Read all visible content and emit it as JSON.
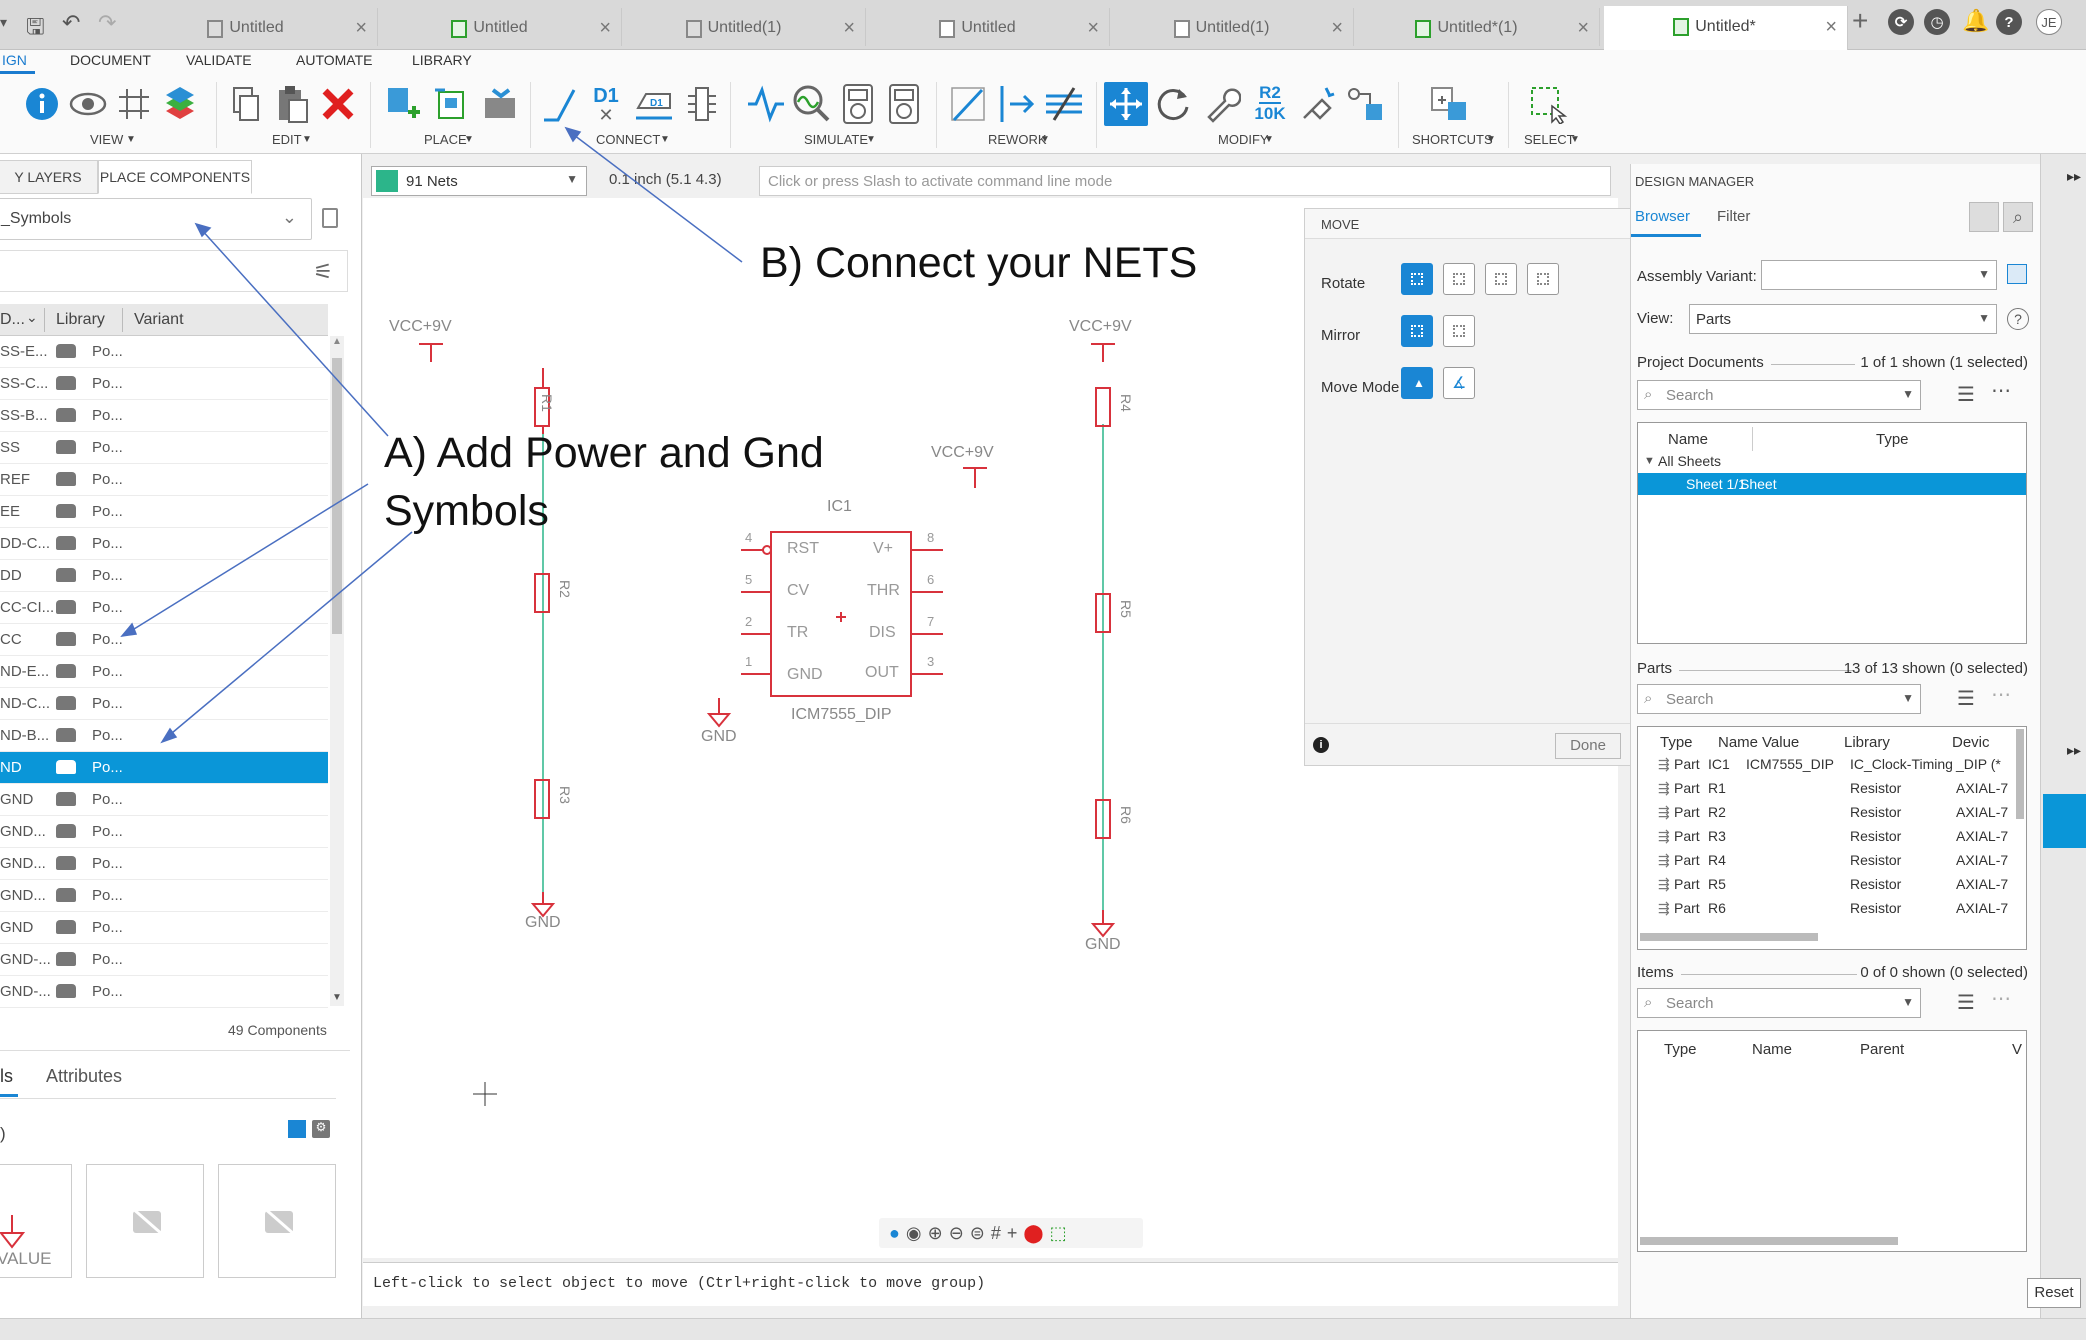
{
  "tabs": [
    {
      "label": "Untitled",
      "kind": "3d"
    },
    {
      "label": "Untitled",
      "kind": "schematic"
    },
    {
      "label": "Untitled(1)",
      "kind": "3d"
    },
    {
      "label": "Untitled",
      "kind": "board"
    },
    {
      "label": "Untitled(1)",
      "kind": "board"
    },
    {
      "label": "Untitled*(1)",
      "kind": "schematic"
    },
    {
      "label": "Untitled*",
      "kind": "schematic"
    }
  ],
  "user_initials": "JE",
  "ribbon": {
    "tabs": [
      "IGN",
      "DOCUMENT",
      "VALIDATE",
      "AUTOMATE",
      "LIBRARY"
    ],
    "groups": [
      "VIEW",
      "EDIT",
      "PLACE",
      "CONNECT",
      "SIMULATE",
      "REWORK",
      "MODIFY",
      "SHORTCUTS",
      "SELECT"
    ],
    "connect_d1": "D1",
    "modify_r2": "R2",
    "modify_10k": "10K"
  },
  "left_panel": {
    "tabs": [
      "Y LAYERS",
      "PLACE COMPONENTS"
    ],
    "library_select": "_Symbols",
    "columns": [
      "D...",
      "Library",
      "Variant"
    ],
    "rows": [
      {
        "name": "SS-E...",
        "lib": "Po..."
      },
      {
        "name": "SS-C...",
        "lib": "Po..."
      },
      {
        "name": "SS-B...",
        "lib": "Po..."
      },
      {
        "name": "SS",
        "lib": "Po..."
      },
      {
        "name": "REF",
        "lib": "Po..."
      },
      {
        "name": "EE",
        "lib": "Po..."
      },
      {
        "name": "DD-C...",
        "lib": "Po..."
      },
      {
        "name": "DD",
        "lib": "Po..."
      },
      {
        "name": "CC-CI...",
        "lib": "Po..."
      },
      {
        "name": "CC",
        "lib": "Po..."
      },
      {
        "name": "ND-E...",
        "lib": "Po..."
      },
      {
        "name": "ND-C...",
        "lib": "Po..."
      },
      {
        "name": "ND-B...",
        "lib": "Po..."
      },
      {
        "name": "ND",
        "lib": "Po...",
        "selected": true
      },
      {
        "name": "GND",
        "lib": "Po..."
      },
      {
        "name": "GND...",
        "lib": "Po..."
      },
      {
        "name": "GND...",
        "lib": "Po..."
      },
      {
        "name": "GND...",
        "lib": "Po..."
      },
      {
        "name": "GND",
        "lib": "Po..."
      },
      {
        "name": "GND-...",
        "lib": "Po..."
      },
      {
        "name": "GND-...",
        "lib": "Po..."
      }
    ],
    "component_count": "49 Components",
    "detail_tabs": [
      "ls",
      "Attributes"
    ],
    "detail_left": ")",
    "preview_value": "VALUE"
  },
  "command": {
    "nets": "91 Nets",
    "grid": "0.1 inch (5.1 4.3)",
    "placeholder": "Click or press Slash to activate command line mode"
  },
  "status_text": "Left-click to select object to move (Ctrl+right-click to move group)",
  "annotations": {
    "a_line1": "A) Add Power and Gnd",
    "a_line2": "Symbols",
    "b": "B) Connect your NETS"
  },
  "schematic": {
    "vcc1": "VCC+9V",
    "vcc2": "VCC+9V",
    "vcc3": "VCC+9V",
    "gnd1": "GND",
    "gnd2": "GND",
    "gnd3": "GND",
    "ic_name": "IC1",
    "ic_value": "ICM7555_DIP",
    "pins": {
      "p4": "4",
      "p5": "5",
      "p2": "2",
      "p1": "1",
      "p8": "8",
      "p6": "6",
      "p7": "7",
      "p3": "3",
      "rst": "RST",
      "cv": "CV",
      "tr": "TR",
      "gnd": "GND",
      "vplus": "V+",
      "thr": "THR",
      "dis": "DIS",
      "out": "OUT"
    },
    "resistors": [
      "R1",
      "R2",
      "R3",
      "R4",
      "R5",
      "R6"
    ]
  },
  "move_panel": {
    "title": "MOVE",
    "rotate": "Rotate",
    "mirror": "Mirror",
    "move_mode": "Move Mode",
    "done": "Done"
  },
  "design_manager": {
    "title": "DESIGN MANAGER",
    "tabs": [
      "Browser",
      "Filter"
    ],
    "assembly_label": "Assembly Variant:",
    "view_label": "View:",
    "view_value": "Parts",
    "project_docs": "Project Documents",
    "project_docs_count": "1 of 1 shown (1 selected)",
    "search_placeholder": "Search",
    "doc_columns": [
      "Name",
      "Type"
    ],
    "all_sheets": "All Sheets",
    "sheet_name": "Sheet 1/1",
    "sheet_type": "Sheet",
    "parts_title": "Parts",
    "parts_count": "13 of 13 shown (0 selected)",
    "parts_columns": [
      "Type",
      "Name",
      "Value",
      "Library",
      "Devic"
    ],
    "parts": [
      {
        "type": "Part",
        "name": "IC1",
        "value": "ICM7555_DIP",
        "library": "IC_Clock-Timing",
        "device": "_DIP (*"
      },
      {
        "type": "Part",
        "name": "R1",
        "value": "",
        "library": "Resistor",
        "device": "AXIAL-7"
      },
      {
        "type": "Part",
        "name": "R2",
        "value": "",
        "library": "Resistor",
        "device": "AXIAL-7"
      },
      {
        "type": "Part",
        "name": "R3",
        "value": "",
        "library": "Resistor",
        "device": "AXIAL-7"
      },
      {
        "type": "Part",
        "name": "R4",
        "value": "",
        "library": "Resistor",
        "device": "AXIAL-7"
      },
      {
        "type": "Part",
        "name": "R5",
        "value": "",
        "library": "Resistor",
        "device": "AXIAL-7"
      },
      {
        "type": "Part",
        "name": "R6",
        "value": "",
        "library": "Resistor",
        "device": "AXIAL-7"
      }
    ],
    "items_title": "Items",
    "items_count": "0 of 0 shown (0 selected)",
    "items_columns": [
      "Type",
      "Name",
      "Parent",
      "V"
    ],
    "reset": "Reset"
  },
  "colors": {
    "accent": "#0a96d8",
    "symbol_red": "#d8323c",
    "net_green": "#2cb58a",
    "annotation_blue": "#4a6fc1"
  }
}
